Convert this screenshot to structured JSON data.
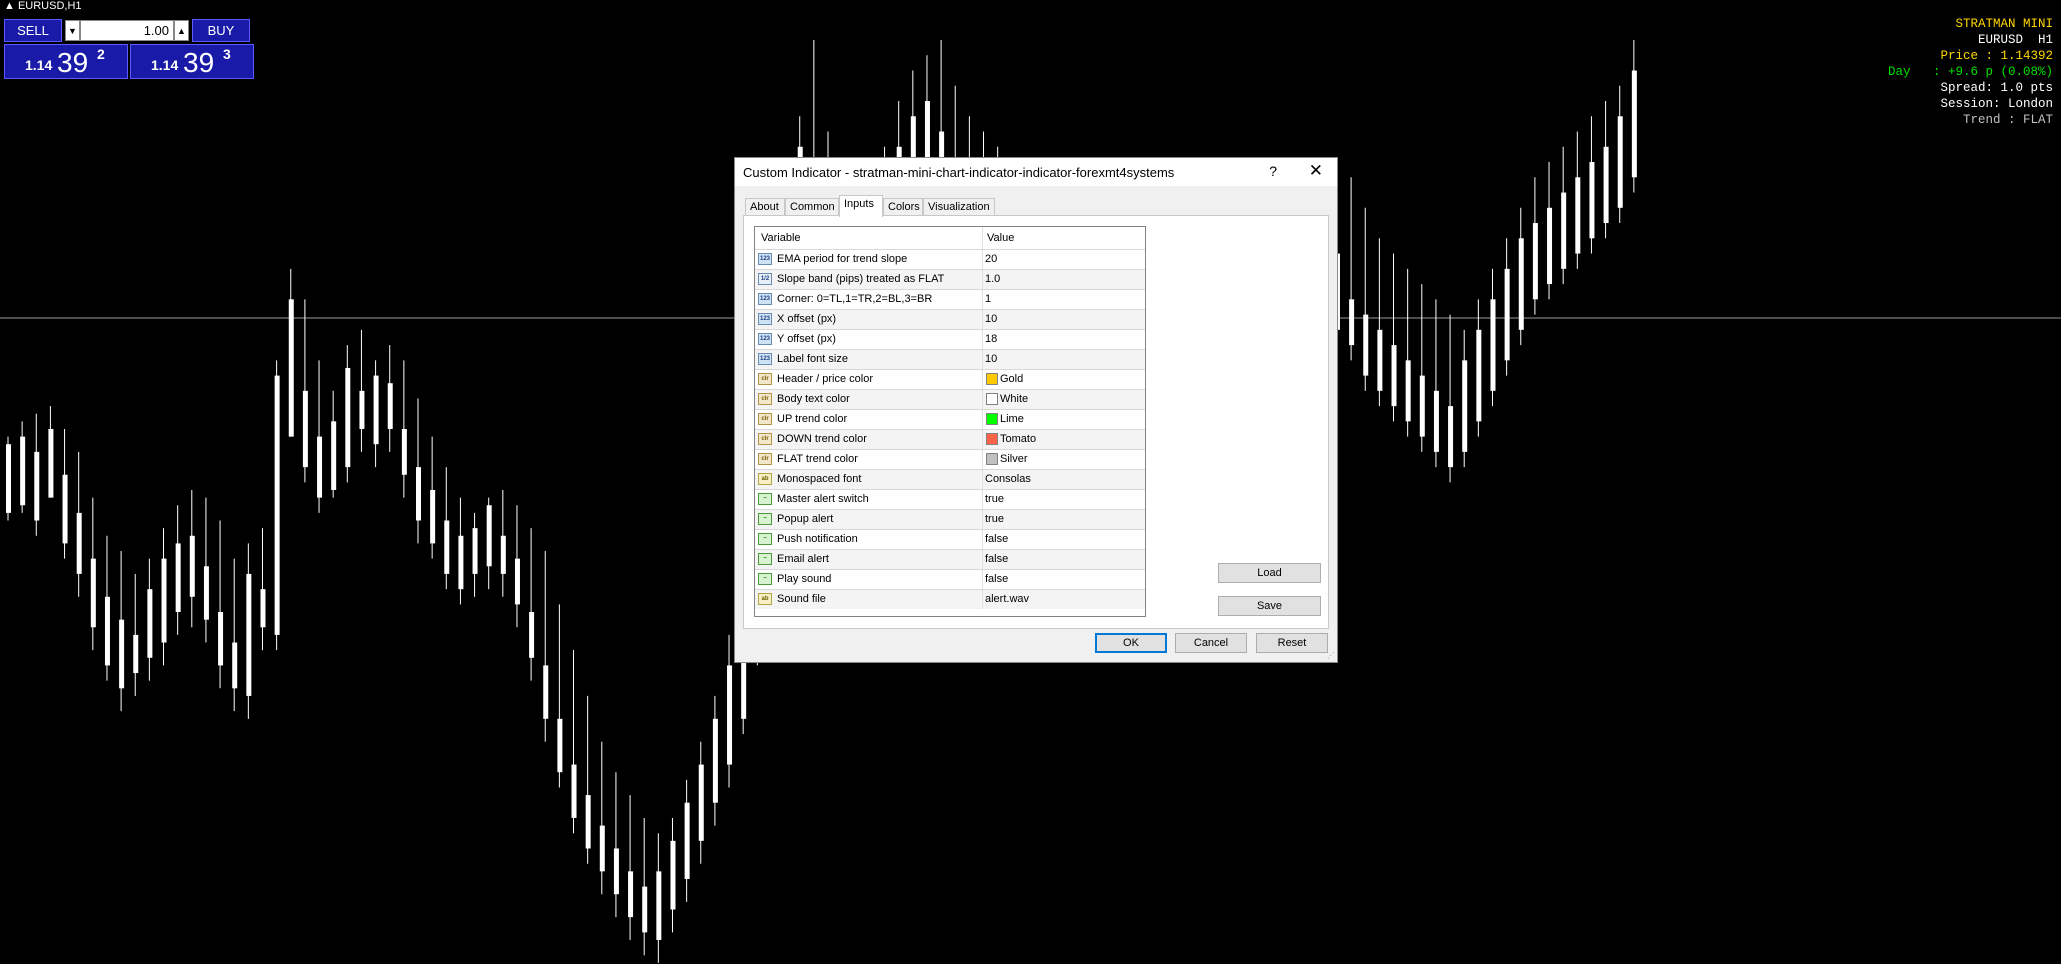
{
  "window": {
    "symbol_label": "EURUSD,H1"
  },
  "trade_panel": {
    "sell_label": "SELL",
    "buy_label": "BUY",
    "lot_value": "1.00",
    "bid_prefix": "1.14",
    "bid_big": "39",
    "bid_sup": "2",
    "ask_prefix": "1.14",
    "ask_big": "39",
    "ask_sup": "3"
  },
  "stratman": {
    "title": "STRATMAN MINI",
    "symbol_line": "EURUSD  H1",
    "price_line": "Price : 1.14392",
    "day_line": "Day   : +9.6 p (0.08%)",
    "spread_line": "Spread: 1.0 pts",
    "session_line": "Session: London",
    "trend_line": "Trend : FLAT",
    "colors": {
      "gold": "#ffd700",
      "white": "#ffffff",
      "lime": "#00e000",
      "silver": "#c0c0c0"
    }
  },
  "dialog": {
    "title": "Custom Indicator - stratman-mini-chart-indicator-indicator-forexmt4systems",
    "help": "?",
    "close": "✕",
    "tabs": [
      "About",
      "Common",
      "Inputs",
      "Colors",
      "Visualization"
    ],
    "active_tab": "Inputs",
    "grid_header": {
      "variable": "Variable",
      "value": "Value"
    },
    "rows": [
      {
        "icon": "int-icon",
        "kind": "int",
        "name": "EMA period for trend slope",
        "value": "20"
      },
      {
        "icon": "double-icon",
        "kind": "dbl",
        "name": "Slope band (pips) treated as FLAT",
        "value": "1.0"
      },
      {
        "icon": "int-icon",
        "kind": "int",
        "name": "Corner: 0=TL,1=TR,2=BL,3=BR",
        "value": "1"
      },
      {
        "icon": "int-icon",
        "kind": "int",
        "name": "X offset (px)",
        "value": "10"
      },
      {
        "icon": "int-icon",
        "kind": "int",
        "name": "Y offset (px)",
        "value": "18"
      },
      {
        "icon": "int-icon",
        "kind": "int",
        "name": "Label font size",
        "value": "10"
      },
      {
        "icon": "color-icon",
        "kind": "clr",
        "name": "Header / price color",
        "value": "Gold",
        "swatch": "#ffc800"
      },
      {
        "icon": "color-icon",
        "kind": "clr",
        "name": "Body text color",
        "value": "White",
        "swatch": "#ffffff"
      },
      {
        "icon": "color-icon",
        "kind": "clr",
        "name": "UP trend color",
        "value": "Lime",
        "swatch": "#00ff00"
      },
      {
        "icon": "color-icon",
        "kind": "clr",
        "name": "DOWN trend color",
        "value": "Tomato",
        "swatch": "#ff6347"
      },
      {
        "icon": "color-icon",
        "kind": "clr",
        "name": "FLAT trend color",
        "value": "Silver",
        "swatch": "#c0c0c0"
      },
      {
        "icon": "string-icon",
        "kind": "str",
        "name": "Monospaced font",
        "value": "Consolas"
      },
      {
        "icon": "bool-icon",
        "kind": "bool",
        "name": "Master alert switch",
        "value": "true"
      },
      {
        "icon": "bool-icon",
        "kind": "bool",
        "name": "Popup alert",
        "value": "true"
      },
      {
        "icon": "bool-icon",
        "kind": "bool",
        "name": "Push notification",
        "value": "false"
      },
      {
        "icon": "bool-icon",
        "kind": "bool",
        "name": "Email alert",
        "value": "false"
      },
      {
        "icon": "bool-icon",
        "kind": "bool",
        "name": "Play sound",
        "value": "false"
      },
      {
        "icon": "string-icon",
        "kind": "str",
        "name": "Sound file",
        "value": "alert.wav"
      }
    ],
    "buttons": {
      "load": "Load",
      "save": "Save",
      "ok": "OK",
      "cancel": "Cancel",
      "reset": "Reset"
    }
  },
  "chart_data": {
    "type": "candlestick",
    "bull_color": "#ffffff",
    "bear_color": "#0000ff",
    "candles": [
      [
        240,
        235,
        239,
        230
      ],
      [
        242,
        236,
        240,
        231
      ],
      [
        243,
        233,
        238,
        229
      ],
      [
        244,
        238,
        241,
        232
      ],
      [
        241,
        230,
        235,
        226
      ],
      [
        238,
        225,
        230,
        222
      ],
      [
        232,
        218,
        224,
        215
      ],
      [
        227,
        214,
        219,
        210
      ],
      [
        225,
        210,
        216,
        207
      ],
      [
        222,
        212,
        214,
        209
      ],
      [
        224,
        214,
        220,
        211
      ],
      [
        228,
        216,
        224,
        213
      ],
      [
        231,
        220,
        226,
        217
      ],
      [
        233,
        221,
        227,
        219
      ],
      [
        232,
        219,
        223,
        216
      ],
      [
        229,
        213,
        217,
        210
      ],
      [
        224,
        210,
        213,
        207
      ],
      [
        226,
        209,
        222,
        206
      ],
      [
        228,
        218,
        220,
        215
      ],
      [
        250,
        218,
        248,
        214
      ],
      [
        262,
        246,
        258,
        240
      ],
      [
        258,
        240,
        246,
        236
      ],
      [
        250,
        236,
        240,
        232
      ],
      [
        246,
        238,
        242,
        233
      ],
      [
        252,
        240,
        249,
        236
      ],
      [
        254,
        244,
        246,
        241
      ],
      [
        250,
        242,
        248,
        239
      ],
      [
        252,
        244,
        247,
        241
      ],
      [
        250,
        238,
        241,
        235
      ],
      [
        245,
        232,
        236,
        229
      ],
      [
        240,
        230,
        233,
        226
      ],
      [
        236,
        226,
        229,
        222
      ],
      [
        232,
        224,
        227,
        220
      ],
      [
        230,
        225,
        228,
        222
      ],
      [
        232,
        226,
        231,
        223
      ],
      [
        233,
        225,
        227,
        222
      ],
      [
        231,
        221,
        224,
        218
      ],
      [
        228,
        214,
        217,
        211
      ],
      [
        225,
        206,
        210,
        203
      ],
      [
        218,
        200,
        203,
        196
      ],
      [
        212,
        194,
        197,
        190
      ],
      [
        206,
        190,
        193,
        186
      ],
      [
        200,
        186,
        189,
        183
      ],
      [
        196,
        183,
        186,
        180
      ],
      [
        193,
        180,
        183,
        177
      ],
      [
        190,
        178,
        181,
        175
      ],
      [
        188,
        177,
        183,
        174
      ],
      [
        190,
        181,
        187,
        178
      ],
      [
        195,
        185,
        192,
        182
      ],
      [
        200,
        190,
        197,
        187
      ],
      [
        206,
        195,
        203,
        192
      ],
      [
        214,
        200,
        210,
        197
      ],
      [
        224,
        207,
        220,
        203
      ],
      [
        236,
        216,
        231,
        212
      ],
      [
        252,
        226,
        248,
        222
      ],
      [
        268,
        244,
        264,
        240
      ],
      [
        282,
        258,
        278,
        254
      ],
      [
        292,
        270,
        274,
        266
      ],
      [
        280,
        262,
        266,
        258
      ],
      [
        272,
        256,
        260,
        252
      ],
      [
        268,
        252,
        262,
        248
      ],
      [
        272,
        258,
        268,
        254
      ],
      [
        278,
        264,
        274,
        260
      ],
      [
        284,
        268,
        278,
        264
      ],
      [
        288,
        274,
        282,
        270
      ],
      [
        290,
        276,
        284,
        272
      ],
      [
        292,
        278,
        280,
        274
      ],
      [
        286,
        272,
        276,
        268
      ],
      [
        282,
        268,
        272,
        264
      ],
      [
        280,
        266,
        270,
        262
      ],
      [
        278,
        262,
        266,
        258
      ],
      [
        274,
        260,
        264,
        256
      ],
      [
        272,
        258,
        262,
        254
      ],
      [
        270,
        256,
        260,
        252
      ],
      [
        266,
        252,
        256,
        248
      ],
      [
        262,
        248,
        252,
        244
      ],
      [
        258,
        244,
        248,
        240
      ],
      [
        254,
        240,
        244,
        236
      ],
      [
        250,
        236,
        240,
        232
      ],
      [
        246,
        232,
        236,
        228
      ],
      [
        242,
        228,
        232,
        224
      ],
      [
        238,
        224,
        228,
        220
      ],
      [
        236,
        222,
        226,
        218
      ],
      [
        238,
        224,
        230,
        220
      ],
      [
        242,
        228,
        234,
        224
      ],
      [
        246,
        232,
        238,
        228
      ],
      [
        250,
        236,
        242,
        232
      ],
      [
        254,
        240,
        246,
        236
      ],
      [
        258,
        244,
        250,
        240
      ],
      [
        262,
        248,
        252,
        244
      ],
      [
        264,
        250,
        256,
        246
      ],
      [
        266,
        252,
        258,
        248
      ],
      [
        268,
        254,
        260,
        250
      ],
      [
        270,
        256,
        262,
        252
      ],
      [
        272,
        258,
        264,
        254
      ],
      [
        274,
        256,
        258,
        252
      ],
      [
        270,
        252,
        256,
        248
      ],
      [
        266,
        250,
        254,
        246
      ],
      [
        264,
        248,
        252,
        244
      ],
      [
        262,
        246,
        250,
        242
      ],
      [
        260,
        244,
        248,
        240
      ],
      [
        258,
        242,
        246,
        238
      ],
      [
        256,
        240,
        244,
        236
      ],
      [
        254,
        242,
        250,
        238
      ],
      [
        258,
        246,
        254,
        242
      ],
      [
        262,
        250,
        258,
        246
      ],
      [
        266,
        254,
        262,
        250
      ],
      [
        270,
        258,
        266,
        254
      ],
      [
        274,
        262,
        268,
        258
      ],
      [
        276,
        264,
        270,
        260
      ],
      [
        278,
        266,
        272,
        262
      ],
      [
        280,
        268,
        274,
        264
      ],
      [
        282,
        270,
        276,
        266
      ],
      [
        284,
        272,
        278,
        268
      ],
      [
        286,
        274,
        282,
        270
      ],
      [
        292,
        278,
        288,
        274
      ]
    ]
  }
}
